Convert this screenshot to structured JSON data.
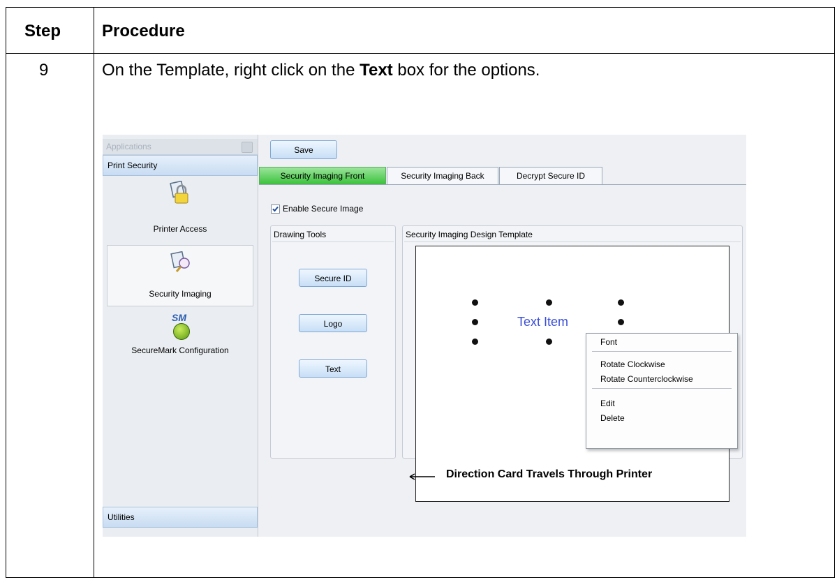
{
  "table": {
    "header_step": "Step",
    "header_procedure": "Procedure",
    "step_number": "9",
    "instruction_pre": "On the Template, right click on the ",
    "instruction_bold": "Text",
    "instruction_post": " box for the options."
  },
  "app": {
    "sidebar": {
      "header": "Applications",
      "section": "Print Security",
      "items": [
        {
          "label": "Printer Access",
          "icon": "printer-lock-icon"
        },
        {
          "label": "Security Imaging",
          "icon": "security-imaging-icon"
        },
        {
          "label": "SecureMark Configuration",
          "icon": "securemark-icon",
          "icon_text": "SM"
        }
      ],
      "footer_section": "Utilities"
    },
    "toolbar": {
      "save_label": "Save"
    },
    "tabs": [
      {
        "label": "Security Imaging Front",
        "active": true
      },
      {
        "label": "Security Imaging Back",
        "active": false
      },
      {
        "label": "Decrypt Secure ID",
        "active": false
      }
    ],
    "enable_checkbox": {
      "label": "Enable Secure Image",
      "checked": true
    },
    "drawing_tools": {
      "title": "Drawing Tools",
      "buttons": [
        "Secure ID",
        "Logo",
        "Text"
      ]
    },
    "template": {
      "title": "Security Imaging Design Template",
      "text_item": "Text Item"
    },
    "context_menu": {
      "items": [
        "Font",
        "Rotate Clockwise",
        "Rotate Counterclockwise",
        "Edit",
        "Delete"
      ]
    },
    "direction_label": "Direction Card Travels Through Printer",
    "colors": {
      "active_tab": "#3bc23b",
      "text_item": "#3b4fd6",
      "button_border": "#7fa7d4"
    }
  }
}
